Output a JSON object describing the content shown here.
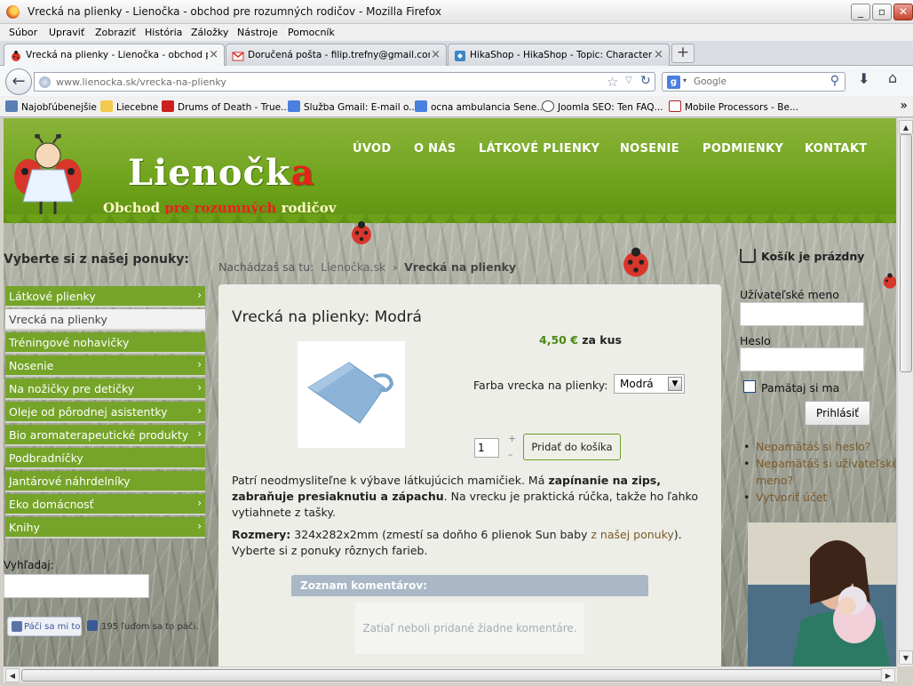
{
  "window": {
    "title": "Vrecká na plienky - Lienočka - obchod pre rozumných rodičov - Mozilla Firefox",
    "minimize": "_",
    "maximize": "▫",
    "close": "✕"
  },
  "menu": [
    "Súbor",
    "Upraviť",
    "Zobraziť",
    "História",
    "Záložky",
    "Nástroje",
    "Pomocník"
  ],
  "tabs": [
    {
      "label": "Vrecká na plienky - Lienočka - obchod pre...",
      "close": "×",
      "icon": "ladybug-favicon",
      "color": "#d9362b"
    },
    {
      "label": "Doručená pošta - filip.trefny@gmail.com ...",
      "close": "×",
      "icon": "gmail-favicon",
      "color": "#d93025"
    },
    {
      "label": "HikaShop - HikaShop - Topic: Characteris...",
      "close": "×",
      "icon": "hikashop-favicon",
      "color": "#3b86c6"
    }
  ],
  "newtab": "+",
  "nav": {
    "back": "←",
    "url_host": "www.lienocka.sk",
    "url_path": "/vrecka-na-plienky",
    "search_placeholder": "Google",
    "search_engine": "g"
  },
  "bookmarks": [
    {
      "label": "Najobľúbenejšie",
      "icon": "#5a7fb8"
    },
    {
      "label": "Liecebne",
      "icon": "#f2c94c"
    },
    {
      "label": "Drums of Death - True...",
      "icon": "#cc1f1f"
    },
    {
      "label": "Služba Gmail: E-mail o...",
      "icon": "#4a7fe0"
    },
    {
      "label": "ocna ambulancia Sene...",
      "icon": "#4a7fe0"
    },
    {
      "label": "Joomla SEO: Ten FAQ...",
      "icon": "#444444"
    },
    {
      "label": "Mobile Processors - Be...",
      "icon": "#b22222"
    }
  ],
  "site": {
    "logo_main": "Lienočk",
    "logo_end": "a",
    "slogan_a": "Obchod ",
    "slogan_b": "pre rozumných",
    "slogan_c": " rodičov",
    "topnav": [
      "ÚVOD",
      "O NÁS",
      "LÁTKOVÉ PLIENKY",
      "NOSENIE",
      "PODMIENKY",
      "KONTAKT"
    ],
    "accent": "#75a428"
  },
  "sidebar": {
    "heading": "Vyberte si z našej ponuky:",
    "items": [
      {
        "label": "Látkové plienky",
        "arrow": "›"
      },
      {
        "label": "Vrecká na plienky",
        "arrow": ""
      },
      {
        "label": "Tréningové nohavičky",
        "arrow": ""
      },
      {
        "label": "Nosenie",
        "arrow": "›"
      },
      {
        "label": "Na nožičky pre detičky",
        "arrow": "›"
      },
      {
        "label": "Oleje od pôrodnej asistentky",
        "arrow": "›"
      },
      {
        "label": "Bio aromaterapeutické produkty",
        "arrow": "›"
      },
      {
        "label": "Podbradníčky",
        "arrow": ""
      },
      {
        "label": "Jantárové náhrdelníky",
        "arrow": ""
      },
      {
        "label": "Eko domácnosť",
        "arrow": "›"
      },
      {
        "label": "Knihy",
        "arrow": "›"
      }
    ],
    "search_label": "Vyhľadaj:",
    "like_label": "Páči sa mi to",
    "like_count": "195 ľuďom sa to páči."
  },
  "breadcrumb": {
    "prefix": "Nachádzaš sa tu:",
    "home": "Lienočka.sk",
    "sep": "›",
    "current": "Vrecká na plienky"
  },
  "product": {
    "title": "Vrecká na plienky: Modrá",
    "price": "4,50 €",
    "price_unit": "za kus",
    "option_label": "Farba vrecka na plienky:",
    "option_value": "Modrá",
    "qty": "1",
    "qty_up": "+",
    "qty_down": "–",
    "add_button": "Pridať do košíka",
    "desc_1": "Patrí neodmysliteľne k výbave látkujúcich mamičiek. Má ",
    "desc_1b": "zapínanie na zips, zabraňuje presiaknutiu a zápachu",
    "desc_1c": ". Na vrecku je praktická rúčka, takže ho ľahko vytiahnete z tašky.",
    "desc_2a": "Rozmery:",
    "desc_2b": " 324x282x2mm (zmestí sa doňho 6 plienok Sun baby ",
    "desc_2link": "z našej ponuky",
    "desc_2c": "). Vyberte si z ponuky rôznych farieb.",
    "comments_title": "Zoznam komentárov:",
    "comments_empty": "Zatiaľ neboli pridané žiadne komentáre."
  },
  "right": {
    "cart": "Košík je prázdny",
    "username_label": "Užívateľské meno",
    "password_label": "Heslo",
    "remember": "Pamätaj si ma",
    "login": "Prihlásiť",
    "links": [
      "Nepamätáš si heslo?",
      "Nepamätáš si užívateľské meno?",
      "Vytvoriť účet"
    ]
  }
}
